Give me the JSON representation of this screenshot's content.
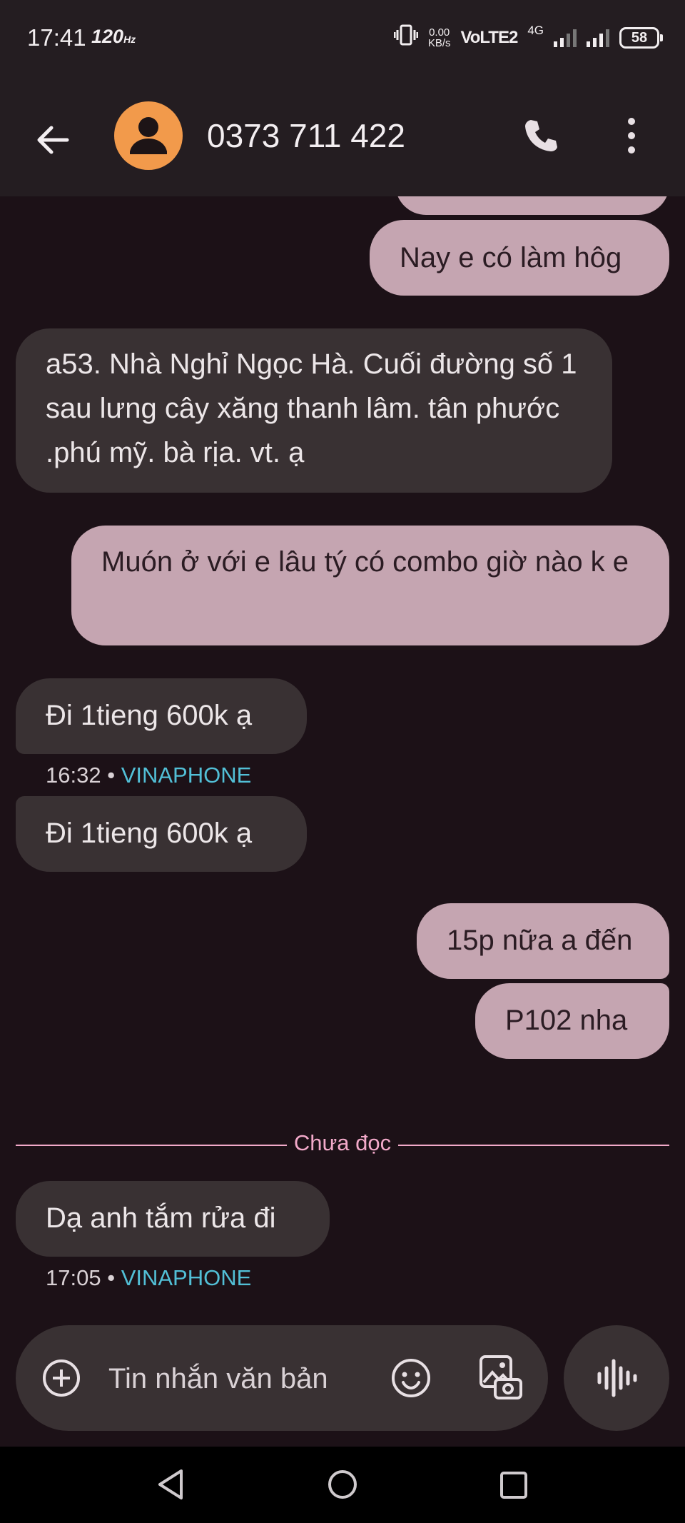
{
  "status_bar": {
    "time": "17:41",
    "refresh_rate": "120",
    "refresh_unit": "Hz",
    "net_speed_value": "0.00",
    "net_speed_unit": "KB/s",
    "volte": "VoLTE2",
    "network_type": "4G",
    "battery": "58",
    "icons": [
      "vibrate-icon",
      "signal-icon",
      "battery-icon"
    ]
  },
  "app_bar": {
    "contact_name": "0373 711 422",
    "avatar_color": "#f29a4b",
    "icons": [
      "back-arrow-icon",
      "person-icon",
      "phone-icon",
      "more-vert-icon"
    ]
  },
  "messages": [
    {
      "dir": "out",
      "text": "Nay e có làm hôg"
    },
    {
      "dir": "in",
      "text": "a53. Nhà Nghỉ Ngọc Hà. Cuối đường số 1 sau lưng cây xăng thanh lâm. tân phước .phú mỹ. bà rịa. vt. ạ"
    },
    {
      "dir": "out",
      "text": "Muón ở với e lâu tý có combo giờ nào k e"
    },
    {
      "dir": "in",
      "text": "Đi 1tieng 600k ạ",
      "time": "16:32",
      "sim": "VINAPHONE"
    },
    {
      "dir": "in",
      "text": "Đi 1tieng 600k ạ"
    },
    {
      "dir": "out",
      "text": "15p nữa a đến"
    },
    {
      "dir": "out",
      "text": "P102 nha"
    },
    {
      "dir": "in",
      "text": "Dạ anh tắm rửa đi",
      "time": "17:05",
      "sim": "VINAPHONE"
    }
  ],
  "meta_separator": "•",
  "unread_divider": "Chưa đọc",
  "composer": {
    "placeholder": "Tin nhắn văn bản",
    "icons": [
      "add-circle-icon",
      "emoji-icon",
      "gallery-icon",
      "voice-icon"
    ]
  },
  "nav_bar": {
    "icons": [
      "nav-back-icon",
      "nav-home-icon",
      "nav-recents-icon"
    ]
  },
  "colors": {
    "background": "#1c1117",
    "incoming_bubble": "#393133",
    "outgoing_bubble": "#c5a5b1",
    "sim_label": "#52bfd6",
    "unread_divider": "#f2a9c9"
  }
}
